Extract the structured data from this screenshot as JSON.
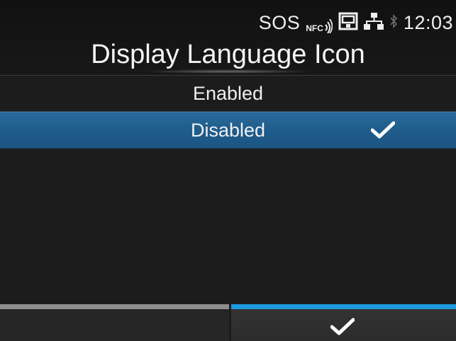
{
  "status_bar": {
    "sos": "SOS",
    "nfc": "NFC",
    "time": "12:03",
    "icons": [
      "nfc-icon",
      "sd-card-icon",
      "network-icon",
      "bluetooth-icon"
    ]
  },
  "header": {
    "title": "Display Language Icon"
  },
  "list": {
    "items": [
      {
        "label": "Enabled",
        "selected": false
      },
      {
        "label": "Disabled",
        "selected": true
      }
    ]
  },
  "bottom_bar": {
    "left_button_icon": "blank",
    "right_button_icon": "check-icon"
  },
  "colors": {
    "selection": "#1f5c8c",
    "accent_blue": "#1e9be0",
    "gray_bar": "#8e8e8e",
    "background": "#1c1c1c"
  }
}
